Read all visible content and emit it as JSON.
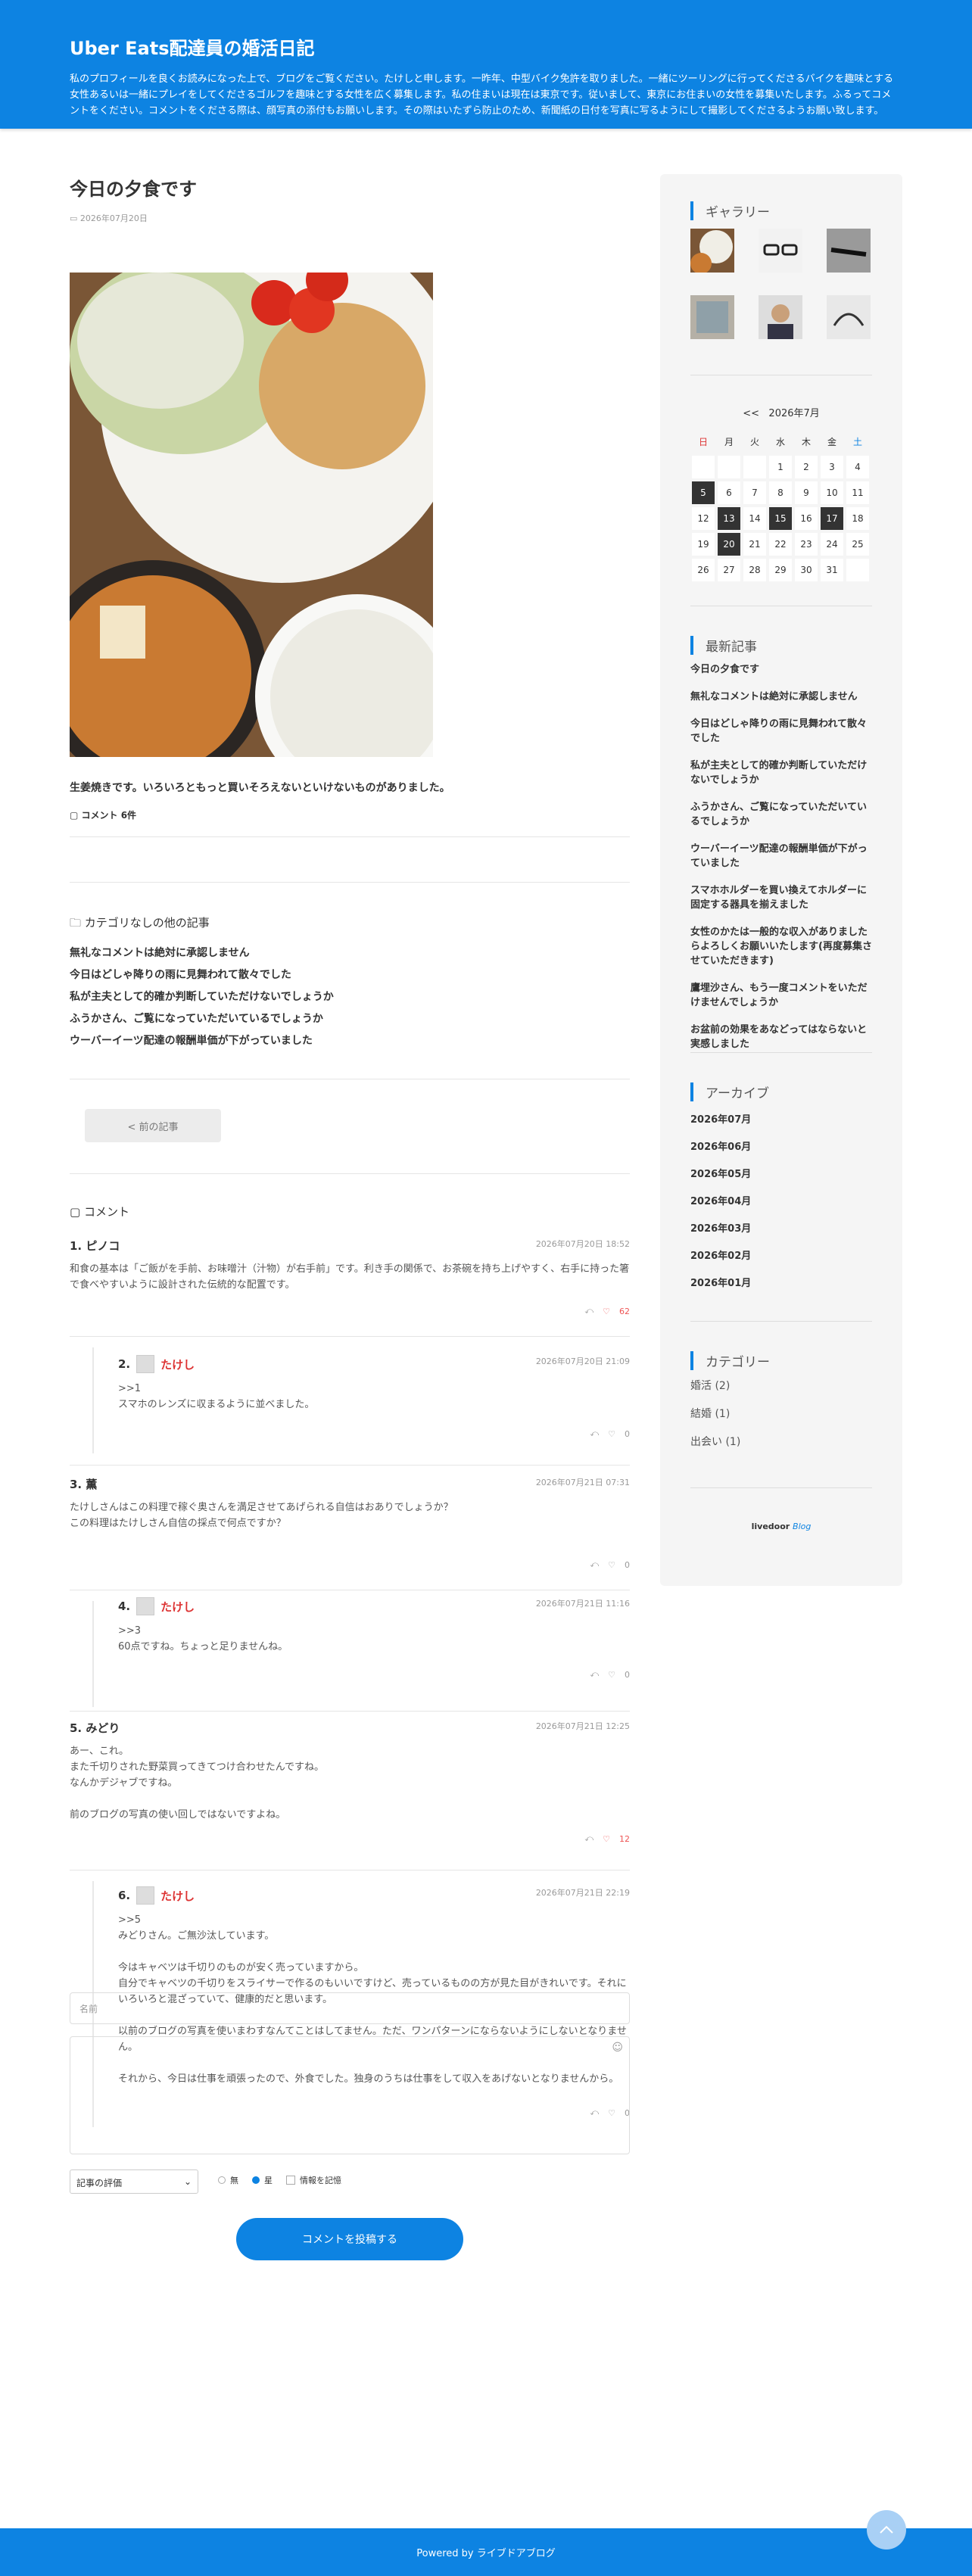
{
  "header": {
    "title": "Uber Eats配達員の婚活日記",
    "description": "私のプロフィールを良くお読みになった上で、ブログをご覧ください。たけしと申します。一昨年、中型バイク免許を取りました。一緒にツーリングに行ってくださるバイクを趣味とする女性あるいは一緒にプレイをしてくださるゴルフを趣味とする女性を広く募集します。私の住まいは現在は東京です。従いまして、東京にお住まいの女性を募集いたします。ふるってコメントをください。コメントをくださる際は、顔写真の添付もお願いします。その際はいたずら防止のため、新聞紙の日付を写真に写るようにして撮影してくださるようお願い致します。"
  },
  "article": {
    "title": "今日の夕食です",
    "date": "2026年07月20日",
    "body": "生姜焼きです。いろいろともっと買いそろえないといけないものがありました。",
    "comment_count": "コメント 6件"
  },
  "related": {
    "title": "カテゴリなしの他の記事",
    "items": [
      "無礼なコメントは絶対に承認しません",
      "今日はどしゃ降りの雨に見舞われて散々でした",
      "私が主夫として的確か判断していただけないでしょうか",
      "ふうかさん、ご覧になっていただいているでしょうか",
      "ウーバーイーツ配達の報酬単価が下がっていました"
    ]
  },
  "nav": {
    "prev": "< 前の記事"
  },
  "comments": {
    "heading": "コメント",
    "list": [
      {
        "num": "1.",
        "author": "ピノコ",
        "date": "2026年07月20日 18:52",
        "text": "和食の基本は「ご飯がを手前、お味噌汁（汁物）が右手前」です。利き手の関係で、お茶碗を持ち上げやすく、右手に持った箸で食べやすいように設計された伝統的な配置です。",
        "likes": "62"
      },
      {
        "num": "2.",
        "author": "たけし",
        "date": "2026年07月20日 21:09",
        "text": ">>1\nスマホのレンズに収まるように並べました。",
        "likes": "0"
      },
      {
        "num": "3.",
        "author": "薫",
        "date": "2026年07月21日 07:31",
        "text": "たけしさんはこの料理で稼ぐ奥さんを満足させてあげられる自信はおありでしょうか？\nこの料理はたけしさん自信の採点で何点ですか？",
        "likes": "0"
      },
      {
        "num": "4.",
        "author": "たけし",
        "date": "2026年07月21日 11:16",
        "text": ">>3\n60点ですね。ちょっと足りませんね。",
        "likes": "0"
      },
      {
        "num": "5.",
        "author": "みどり",
        "date": "2026年07月21日 12:25",
        "text": "あー、これ。\nまた千切りされた野菜買ってきてつけ合わせたんですね。\nなんかデジャブですね。\n\n前のブログの写真の使い回しではないですよね。",
        "likes": "12"
      },
      {
        "num": "6.",
        "author": "たけし",
        "date": "2026年07月21日 22:19",
        "text": ">>5\nみどりさん。ご無沙汰しています。\n\n今はキャベツは千切りのものが安く売っていますから。\n自分でキャベツの千切りをスライサーで作るのもいいですけど、売っているものの方が見た目がきれいです。それにいろいろと混ざっていて、健康的だと思います。\n\n以前のブログの写真を使いまわすなんてことはしてません。ただ、ワンパターンにならないようにしないとなりません。\n\nそれから、今日は仕事を頑張ったので、外食でした。独身のうちは仕事をして収入をあげないとなりませんから。",
        "likes": "0"
      }
    ]
  },
  "form": {
    "name_placeholder": "名前",
    "rating_label": "記事の評価",
    "radio_none": "無",
    "radio_star": "星",
    "remember": "情報を記憶",
    "submit": "コメントを投稿する"
  },
  "sidebar": {
    "gallery_title": "ギャラリー",
    "calendar": {
      "prev": "<<",
      "caption": "2026年7月",
      "weekdays": [
        "日",
        "月",
        "火",
        "水",
        "木",
        "金",
        "土"
      ],
      "days": [
        "",
        "",
        "",
        "1",
        "2",
        "3",
        "4",
        "5",
        "6",
        "7",
        "8",
        "9",
        "10",
        "11",
        "12",
        "13",
        "14",
        "15",
        "16",
        "17",
        "18",
        "19",
        "20",
        "21",
        "22",
        "23",
        "24",
        "25",
        "26",
        "27",
        "28",
        "29",
        "30",
        "31",
        ""
      ]
    },
    "recent_title": "最新記事",
    "recent": [
      "今日の夕食です",
      "無礼なコメントは絶対に承認しません",
      "今日はどしゃ降りの雨に見舞われて散々でした",
      "私が主夫として的確か判断していただけないでしょうか",
      "ふうかさん、ご覧になっていただいているでしょうか",
      "ウーバーイーツ配達の報酬単価が下がっていました",
      "スマホホルダーを買い換えてホルダーに固定する器具を揃えました",
      "女性のかたは一般的な収入がありましたらよろしくお願いいたします(再度募集させていただきます)",
      "鷹埋沙さん、もう一度コメントをいただけませんでしょうか",
      "お盆前の効果をあなどってはならないと実感しました"
    ],
    "archive_title": "アーカイブ",
    "archive": [
      "2026年07月",
      "2026年06月",
      "2026年05月",
      "2026年04月",
      "2026年03月",
      "2026年02月",
      "2026年01月"
    ],
    "category_title": "カテゴリー",
    "categories": [
      "婚活 (2)",
      "結婚 (1)",
      "出会い (1)"
    ],
    "livedoor_a": "livedoor",
    "livedoor_b": "Blog"
  },
  "footer": {
    "text": "Powered by ライブドアブログ"
  },
  "colors": {
    "brand": "#0d83e2",
    "red": "#dd3333"
  }
}
